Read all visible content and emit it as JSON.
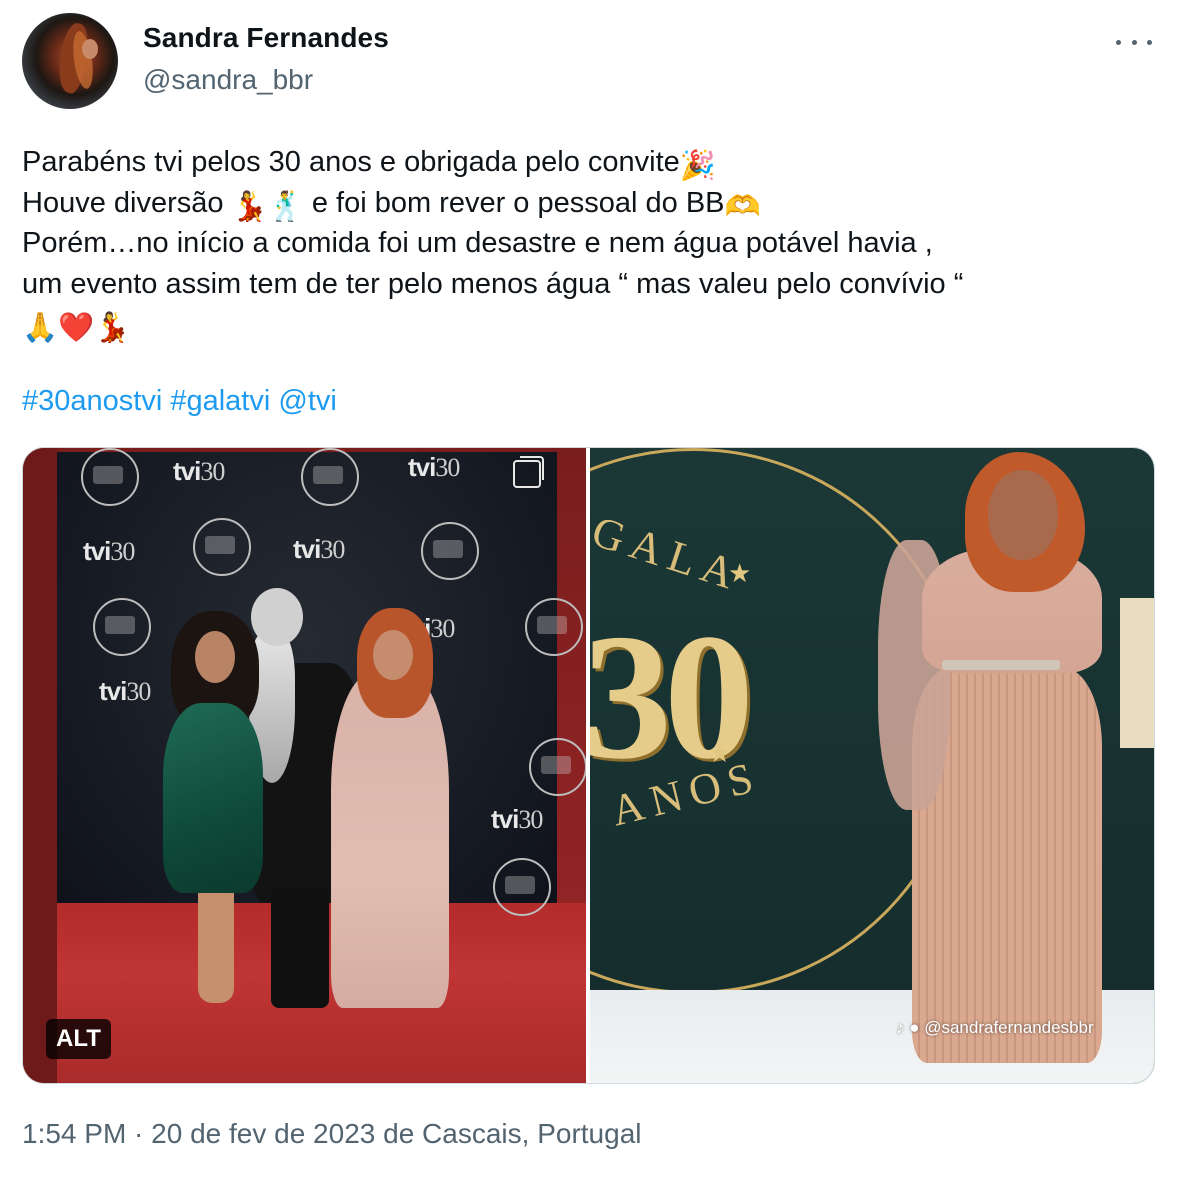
{
  "author": {
    "display_name": "Sandra Fernandes",
    "handle": "@sandra_bbr"
  },
  "tweet": {
    "lines": [
      {
        "text": "Parabéns tvi pelos 30 anos e obrigada pelo convite",
        "emoji": "🎉"
      },
      {
        "text": "Houve diversão ",
        "emoji": "💃🕺",
        "text2": " e foi bom rever o pessoal do BB",
        "emoji2": "🫶"
      },
      {
        "text": "Porém…no início a comida foi um desastre e nem água  potável havia ,"
      },
      {
        "text": " um evento assim tem de ter pelo menos água “ mas valeu pelo convívio “"
      },
      {
        "emoji": "🙏❤️💃"
      }
    ],
    "hashtags": [
      "#30anostvi",
      "#galatvi",
      "@tvi"
    ]
  },
  "media": {
    "alt_badge": "ALT",
    "watermark": "@sandrafernandesbbr",
    "left_logos": [
      "tvi",
      "30"
    ],
    "right_ring_top": "GALA",
    "right_ring_bottom": "ANOS",
    "right_big_number": "30"
  },
  "meta": {
    "text": "1:54 PM · 20 de fev de 2023 de Cascais, Portugal"
  },
  "colors": {
    "link": "#1d9bf0",
    "secondary_text": "#536471",
    "primary_text": "#0f1419"
  },
  "icons": {
    "more": "more-horizontal-icon",
    "layers": "multiple-images-icon",
    "tiktok": "tiktok-icon"
  }
}
